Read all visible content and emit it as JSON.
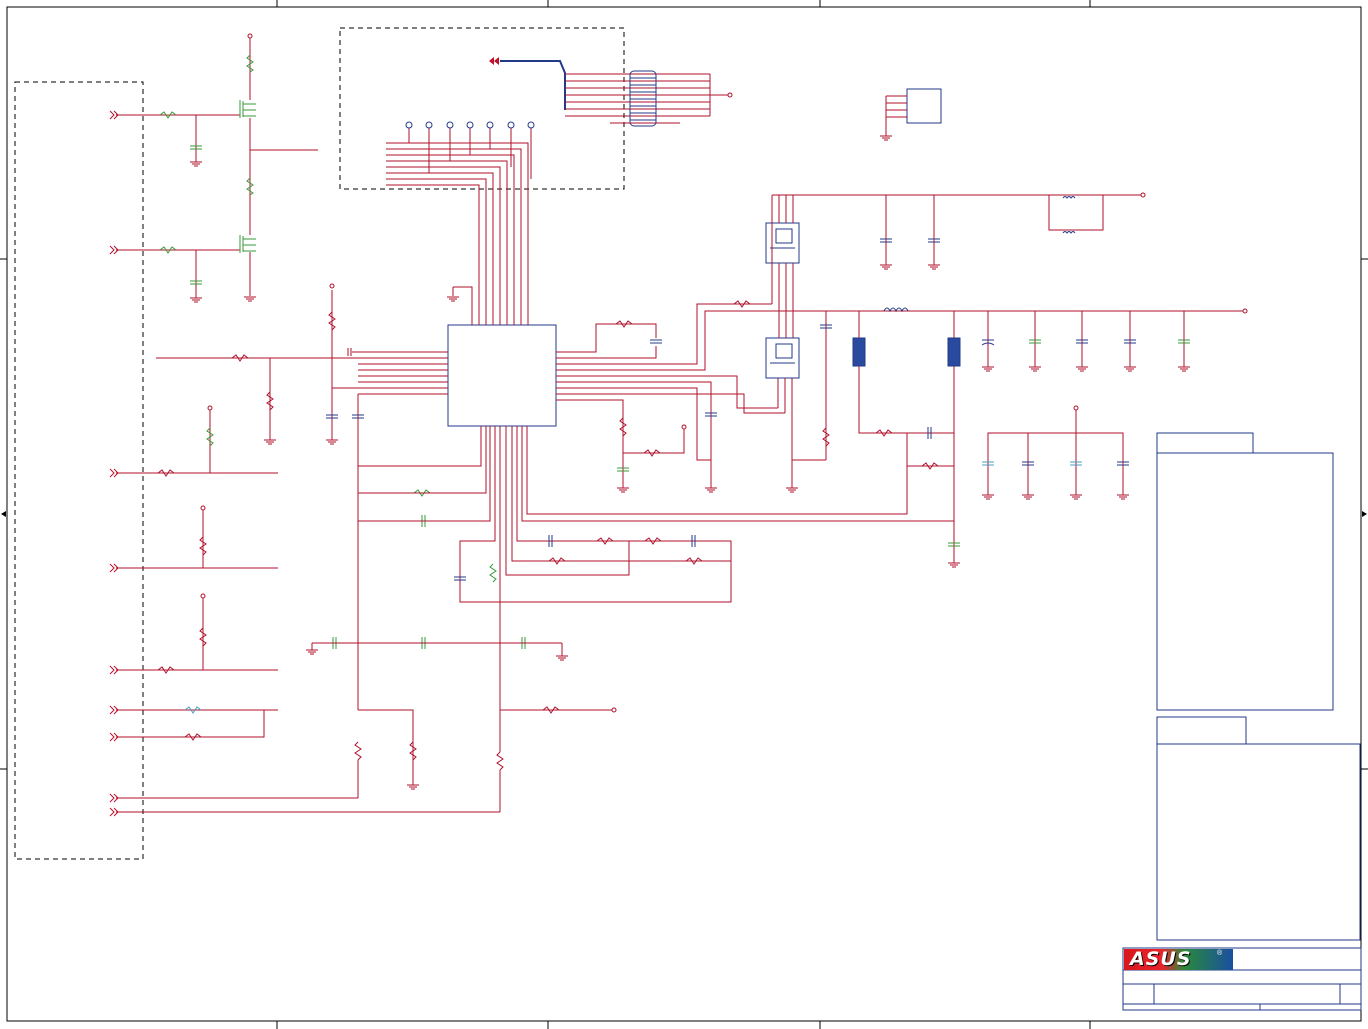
{
  "logo": {
    "brand": "ASUS",
    "registered_mark": "®"
  }
}
